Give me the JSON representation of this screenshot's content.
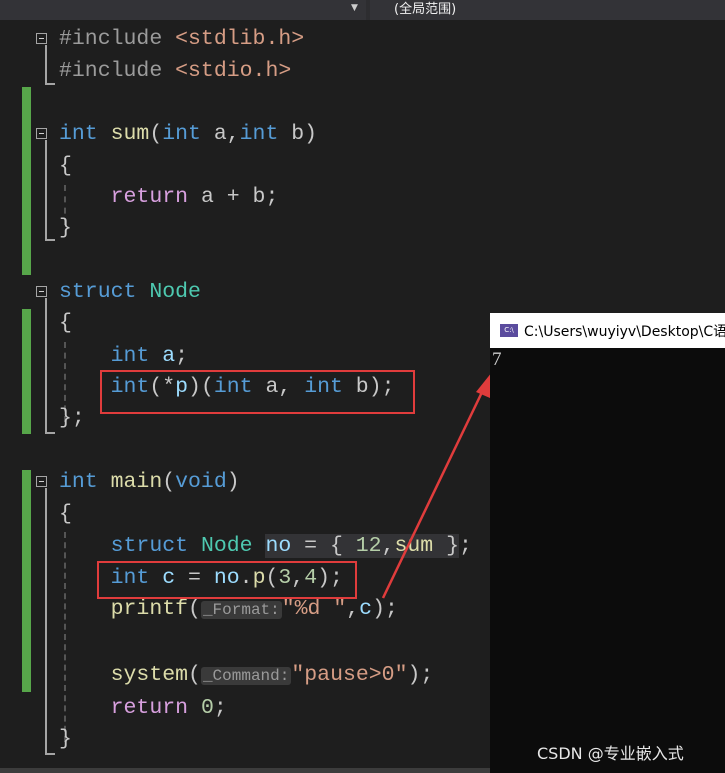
{
  "toolbar": {
    "scope_dropdown_label": "(全局范围)"
  },
  "code": {
    "lines": [
      {
        "tokens": [
          {
            "t": "#include ",
            "c": "pp"
          },
          {
            "t": "<stdlib.h>",
            "c": "inc"
          }
        ]
      },
      {
        "tokens": [
          {
            "t": "#include ",
            "c": "pp"
          },
          {
            "t": "<stdio.h>",
            "c": "inc"
          }
        ]
      },
      {
        "tokens": []
      },
      {
        "tokens": [
          {
            "t": "int ",
            "c": "kw"
          },
          {
            "t": "sum",
            "c": "fn"
          },
          {
            "t": "(",
            "c": "pl"
          },
          {
            "t": "int ",
            "c": "kw"
          },
          {
            "t": "a",
            "c": "pl"
          },
          {
            "t": ",",
            "c": "pl"
          },
          {
            "t": "int ",
            "c": "kw"
          },
          {
            "t": "b",
            "c": "pl"
          },
          {
            "t": ")",
            "c": "pl"
          }
        ]
      },
      {
        "tokens": [
          {
            "t": "{",
            "c": "pl"
          }
        ]
      },
      {
        "tokens": [
          {
            "t": "    return ",
            "c": "ctl"
          },
          {
            "t": "a + b;",
            "c": "pl"
          }
        ]
      },
      {
        "tokens": [
          {
            "t": "}",
            "c": "pl"
          }
        ]
      },
      {
        "tokens": []
      },
      {
        "tokens": [
          {
            "t": "struct ",
            "c": "kw"
          },
          {
            "t": "Node",
            "c": "ty"
          }
        ]
      },
      {
        "tokens": [
          {
            "t": "{",
            "c": "pl"
          }
        ]
      },
      {
        "tokens": [
          {
            "t": "    int ",
            "c": "kw"
          },
          {
            "t": "a",
            "c": "var"
          },
          {
            "t": ";",
            "c": "pl"
          }
        ]
      },
      {
        "tokens": [
          {
            "t": "    int",
            "c": "kw"
          },
          {
            "t": "(*",
            "c": "pl"
          },
          {
            "t": "p",
            "c": "var"
          },
          {
            "t": ")(",
            "c": "pl"
          },
          {
            "t": "int ",
            "c": "kw"
          },
          {
            "t": "a, ",
            "c": "pl"
          },
          {
            "t": "int ",
            "c": "kw"
          },
          {
            "t": "b);",
            "c": "pl"
          }
        ]
      },
      {
        "tokens": [
          {
            "t": "};",
            "c": "pl"
          }
        ]
      },
      {
        "tokens": []
      },
      {
        "tokens": [
          {
            "t": "int ",
            "c": "kw"
          },
          {
            "t": "main",
            "c": "fn"
          },
          {
            "t": "(",
            "c": "pl"
          },
          {
            "t": "void",
            "c": "kw"
          },
          {
            "t": ")",
            "c": "pl"
          }
        ]
      },
      {
        "tokens": [
          {
            "t": "{",
            "c": "pl"
          }
        ]
      },
      {
        "tokens": [
          {
            "t": "    struct ",
            "c": "kw"
          },
          {
            "t": "Node ",
            "c": "ty"
          },
          {
            "t": "no",
            "c": "var sel"
          },
          {
            "t": " = { ",
            "c": "pl sel"
          },
          {
            "t": "12",
            "c": "num sel"
          },
          {
            "t": ",",
            "c": "pl sel"
          },
          {
            "t": "sum",
            "c": "fn sel"
          },
          {
            "t": " }",
            "c": "pl sel"
          },
          {
            "t": ";",
            "c": "pl"
          }
        ]
      },
      {
        "tokens": [
          {
            "t": "    int ",
            "c": "kw"
          },
          {
            "t": "c",
            "c": "var"
          },
          {
            "t": " = ",
            "c": "pl"
          },
          {
            "t": "no",
            "c": "var"
          },
          {
            "t": ".",
            "c": "pl"
          },
          {
            "t": "p",
            "c": "fn"
          },
          {
            "t": "(",
            "c": "pl"
          },
          {
            "t": "3",
            "c": "num"
          },
          {
            "t": ",",
            "c": "pl"
          },
          {
            "t": "4",
            "c": "num"
          },
          {
            "t": ");",
            "c": "pl"
          }
        ]
      },
      {
        "tokens": [
          {
            "t": "    printf",
            "c": "fn"
          },
          {
            "t": "(",
            "c": "pl"
          },
          {
            "t": "_Format:",
            "c": "hint"
          },
          {
            "t": "\"%d \"",
            "c": "str"
          },
          {
            "t": ",",
            "c": "pl"
          },
          {
            "t": "c",
            "c": "var"
          },
          {
            "t": ");",
            "c": "pl"
          }
        ]
      },
      {
        "tokens": []
      },
      {
        "tokens": [
          {
            "t": "    system",
            "c": "fn"
          },
          {
            "t": "(",
            "c": "pl"
          },
          {
            "t": "_Command:",
            "c": "hint"
          },
          {
            "t": "\"pause>0\"",
            "c": "str"
          },
          {
            "t": ");",
            "c": "pl"
          }
        ]
      },
      {
        "tokens": [
          {
            "t": "    return ",
            "c": "ctl"
          },
          {
            "t": "0",
            "c": "num"
          },
          {
            "t": ";",
            "c": "pl"
          }
        ]
      },
      {
        "tokens": [
          {
            "t": "}",
            "c": "pl"
          }
        ]
      }
    ]
  },
  "console": {
    "title": "C:\\Users\\wuyiyv\\Desktop\\C语",
    "icon_label": "C:\\",
    "output": "7"
  },
  "annotation_color": "#e03c3c",
  "watermark": "CSDN @专业嵌入式"
}
